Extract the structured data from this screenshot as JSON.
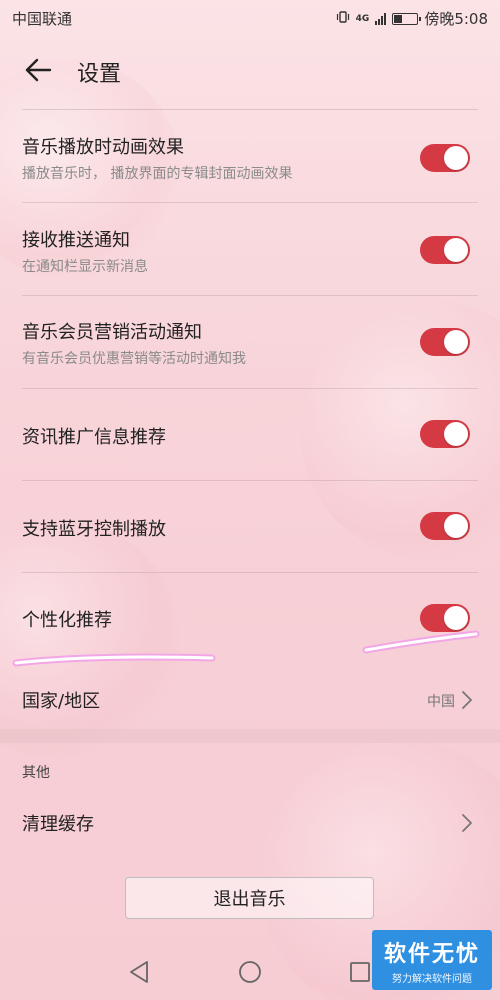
{
  "status_bar": {
    "carrier": "中国联通",
    "network_badge": "4G",
    "time": "傍晚5:08"
  },
  "header": {
    "title": "设置"
  },
  "settings": [
    {
      "title": "音乐播放时动画效果",
      "subtitle": "播放音乐时， 播放界面的专辑封面动画效果",
      "enabled": true
    },
    {
      "title": "接收推送通知",
      "subtitle": "在通知栏显示新消息",
      "enabled": true
    },
    {
      "title": "音乐会员营销活动通知",
      "subtitle": "有音乐会员优惠营销等活动时通知我",
      "enabled": true
    },
    {
      "title": "资讯推广信息推荐",
      "subtitle": "",
      "enabled": true
    },
    {
      "title": "支持蓝牙控制播放",
      "subtitle": "",
      "enabled": true
    },
    {
      "title": "个性化推荐",
      "subtitle": "",
      "enabled": true
    }
  ],
  "region": {
    "label": "国家/地区",
    "value": "中国"
  },
  "other_section": {
    "label": "其他",
    "clear_cache_label": "清理缓存"
  },
  "exit_button": {
    "label": "退出音乐"
  },
  "watermark": {
    "title": "软件无忧",
    "subtitle": "努力解决软件问题"
  },
  "colors": {
    "toggle_on": "#d53a44",
    "background": "#f8d5da",
    "highlight_stroke": "#e040c8"
  },
  "icons": {
    "back": "arrow-left-icon",
    "chevron": "chevron-right-icon",
    "nav_back": "triangle-back-icon",
    "nav_home": "circle-home-icon",
    "nav_recent": "square-recent-icon"
  }
}
